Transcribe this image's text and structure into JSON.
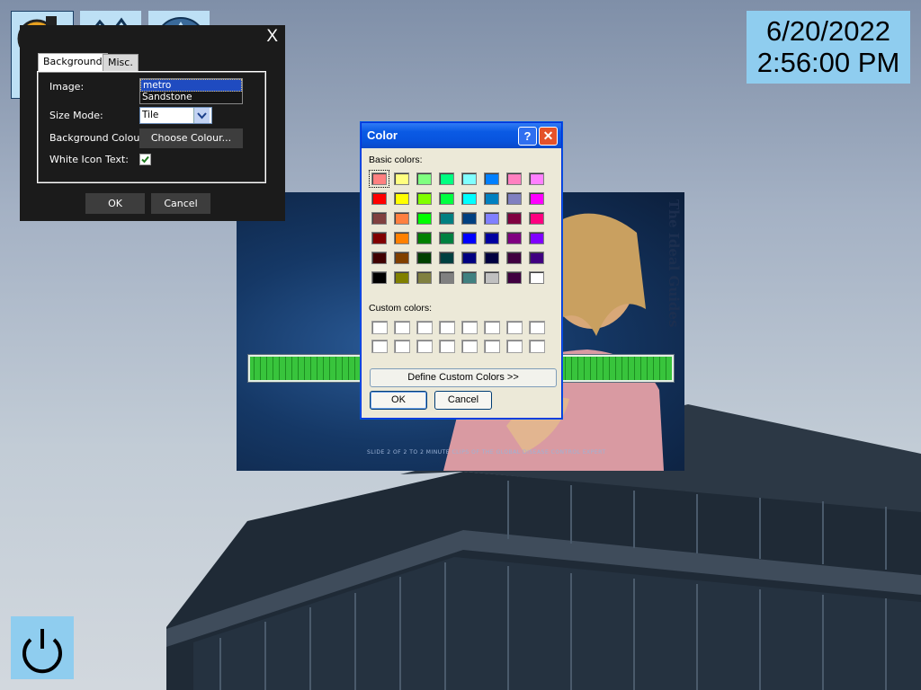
{
  "clock": {
    "date": "6/20/2022",
    "time": "2:56:00 PM"
  },
  "desktop_icons": [
    "app-icon",
    "mountain-icon",
    "triangle-icon"
  ],
  "settings_dialog": {
    "close_label": "X",
    "tabs": [
      "Background",
      "Misc."
    ],
    "active_tab": "Background",
    "image_label": "Image:",
    "image_options": [
      "metro",
      "Sandstone"
    ],
    "image_selected": "metro",
    "size_mode_label": "Size Mode:",
    "size_mode_value": "Tile",
    "background_colour_label": "Background Colour:",
    "choose_colour_label": "Choose Colour...",
    "white_icon_text_label": "White Icon Text:",
    "white_icon_text_checked": true,
    "ok_label": "OK",
    "cancel_label": "Cancel"
  },
  "video": {
    "watermark": "The Ideal Guides",
    "caption": "SLIDE 2 OF 2 TO 2 MINUTE CLIPS OF THE GLOBAL DISEASE CONTROL EXPERT"
  },
  "color_dialog": {
    "title": "Color",
    "help_label": "?",
    "close_label": "✕",
    "basic_colors_label": "Basic colors:",
    "custom_colors_label": "Custom colors:",
    "define_custom_label": "Define Custom Colors >>",
    "ok_label": "OK",
    "cancel_label": "Cancel",
    "basic_colors": [
      [
        "#ff8080",
        "#ffff80",
        "#80ff80",
        "#00ff80",
        "#80ffff",
        "#0080ff",
        "#ff80c0",
        "#ff80ff"
      ],
      [
        "#ff0000",
        "#ffff00",
        "#80ff00",
        "#00ff40",
        "#00ffff",
        "#0080c0",
        "#8080c0",
        "#ff00ff"
      ],
      [
        "#804040",
        "#ff8040",
        "#00ff00",
        "#008080",
        "#004080",
        "#8080ff",
        "#800040",
        "#ff0080"
      ],
      [
        "#800000",
        "#ff8000",
        "#008000",
        "#008040",
        "#0000ff",
        "#0000a0",
        "#800080",
        "#8000ff"
      ],
      [
        "#400000",
        "#804000",
        "#004000",
        "#004040",
        "#000080",
        "#000040",
        "#400040",
        "#400080"
      ],
      [
        "#000000",
        "#808000",
        "#808040",
        "#808080",
        "#408080",
        "#c0c0c0",
        "#400040",
        "#ffffff"
      ]
    ],
    "selected_color": "#ff8080"
  },
  "colors": {
    "tile_blue": "#8fcdef",
    "dialog_dark": "#1b1b1b",
    "xp_title": "#0854de",
    "progress_green": "#38c43c"
  }
}
